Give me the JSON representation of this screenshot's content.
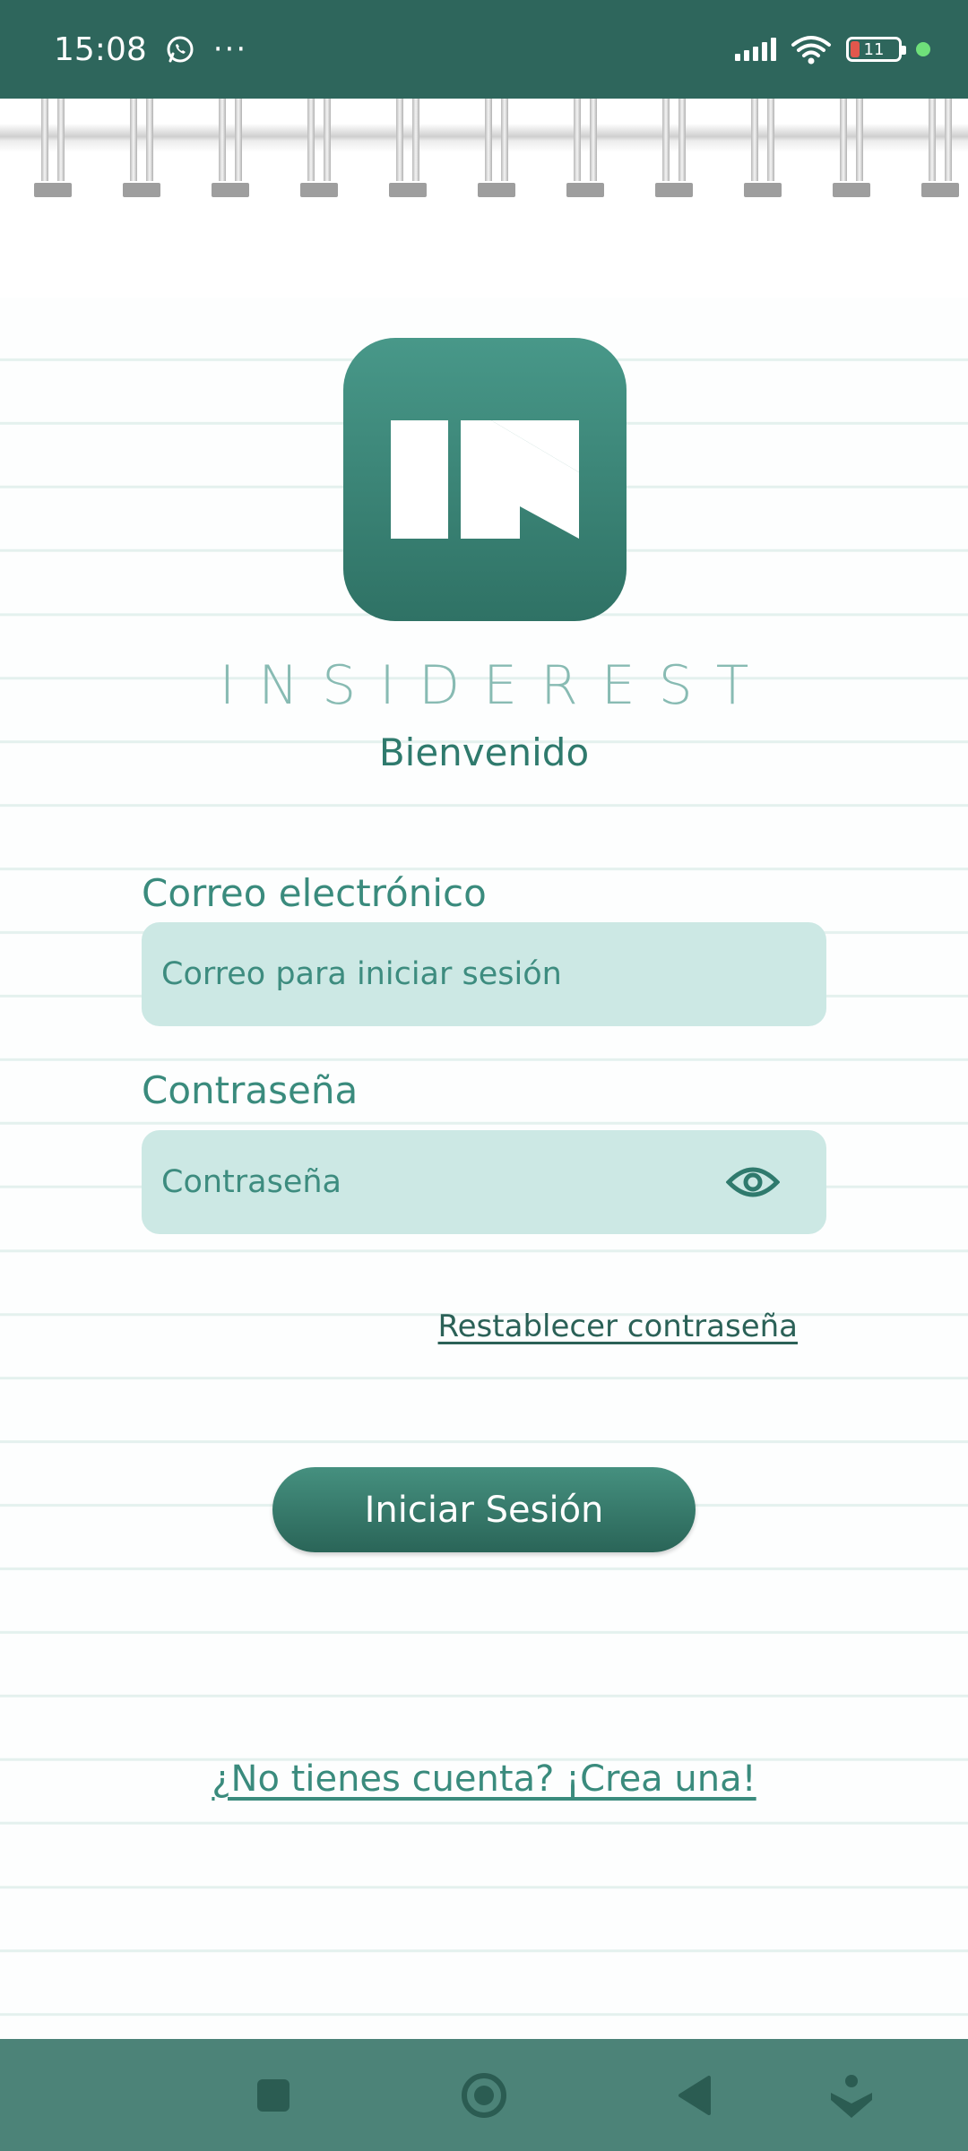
{
  "status_bar": {
    "time": "15:08",
    "more_indicator": "···",
    "battery_level": "11",
    "icons": [
      "whatsapp-icon",
      "signal-icon",
      "wifi-icon",
      "battery-icon",
      "charging-dot"
    ]
  },
  "app": {
    "name": "INSIDEREST",
    "welcome": "Bienvenido",
    "logo_letters": "IN"
  },
  "form": {
    "email_label": "Correo electrónico",
    "email_placeholder": "Correo para iniciar sesión",
    "password_label": "Contraseña",
    "password_placeholder": "Contraseña",
    "reset_link": "Restablecer contraseña",
    "login_button": "Iniciar Sesión",
    "signup_link": "¿No tienes cuenta? ¡Crea una!"
  },
  "nav_bar": {
    "icons": [
      "recents-square-icon",
      "home-circle-icon",
      "back-triangle-icon",
      "assistant-icon"
    ]
  },
  "colors": {
    "primary": "#2e665c",
    "accent": "#489889",
    "input_fill": "#cce8e4",
    "nav": "#4c8378"
  }
}
